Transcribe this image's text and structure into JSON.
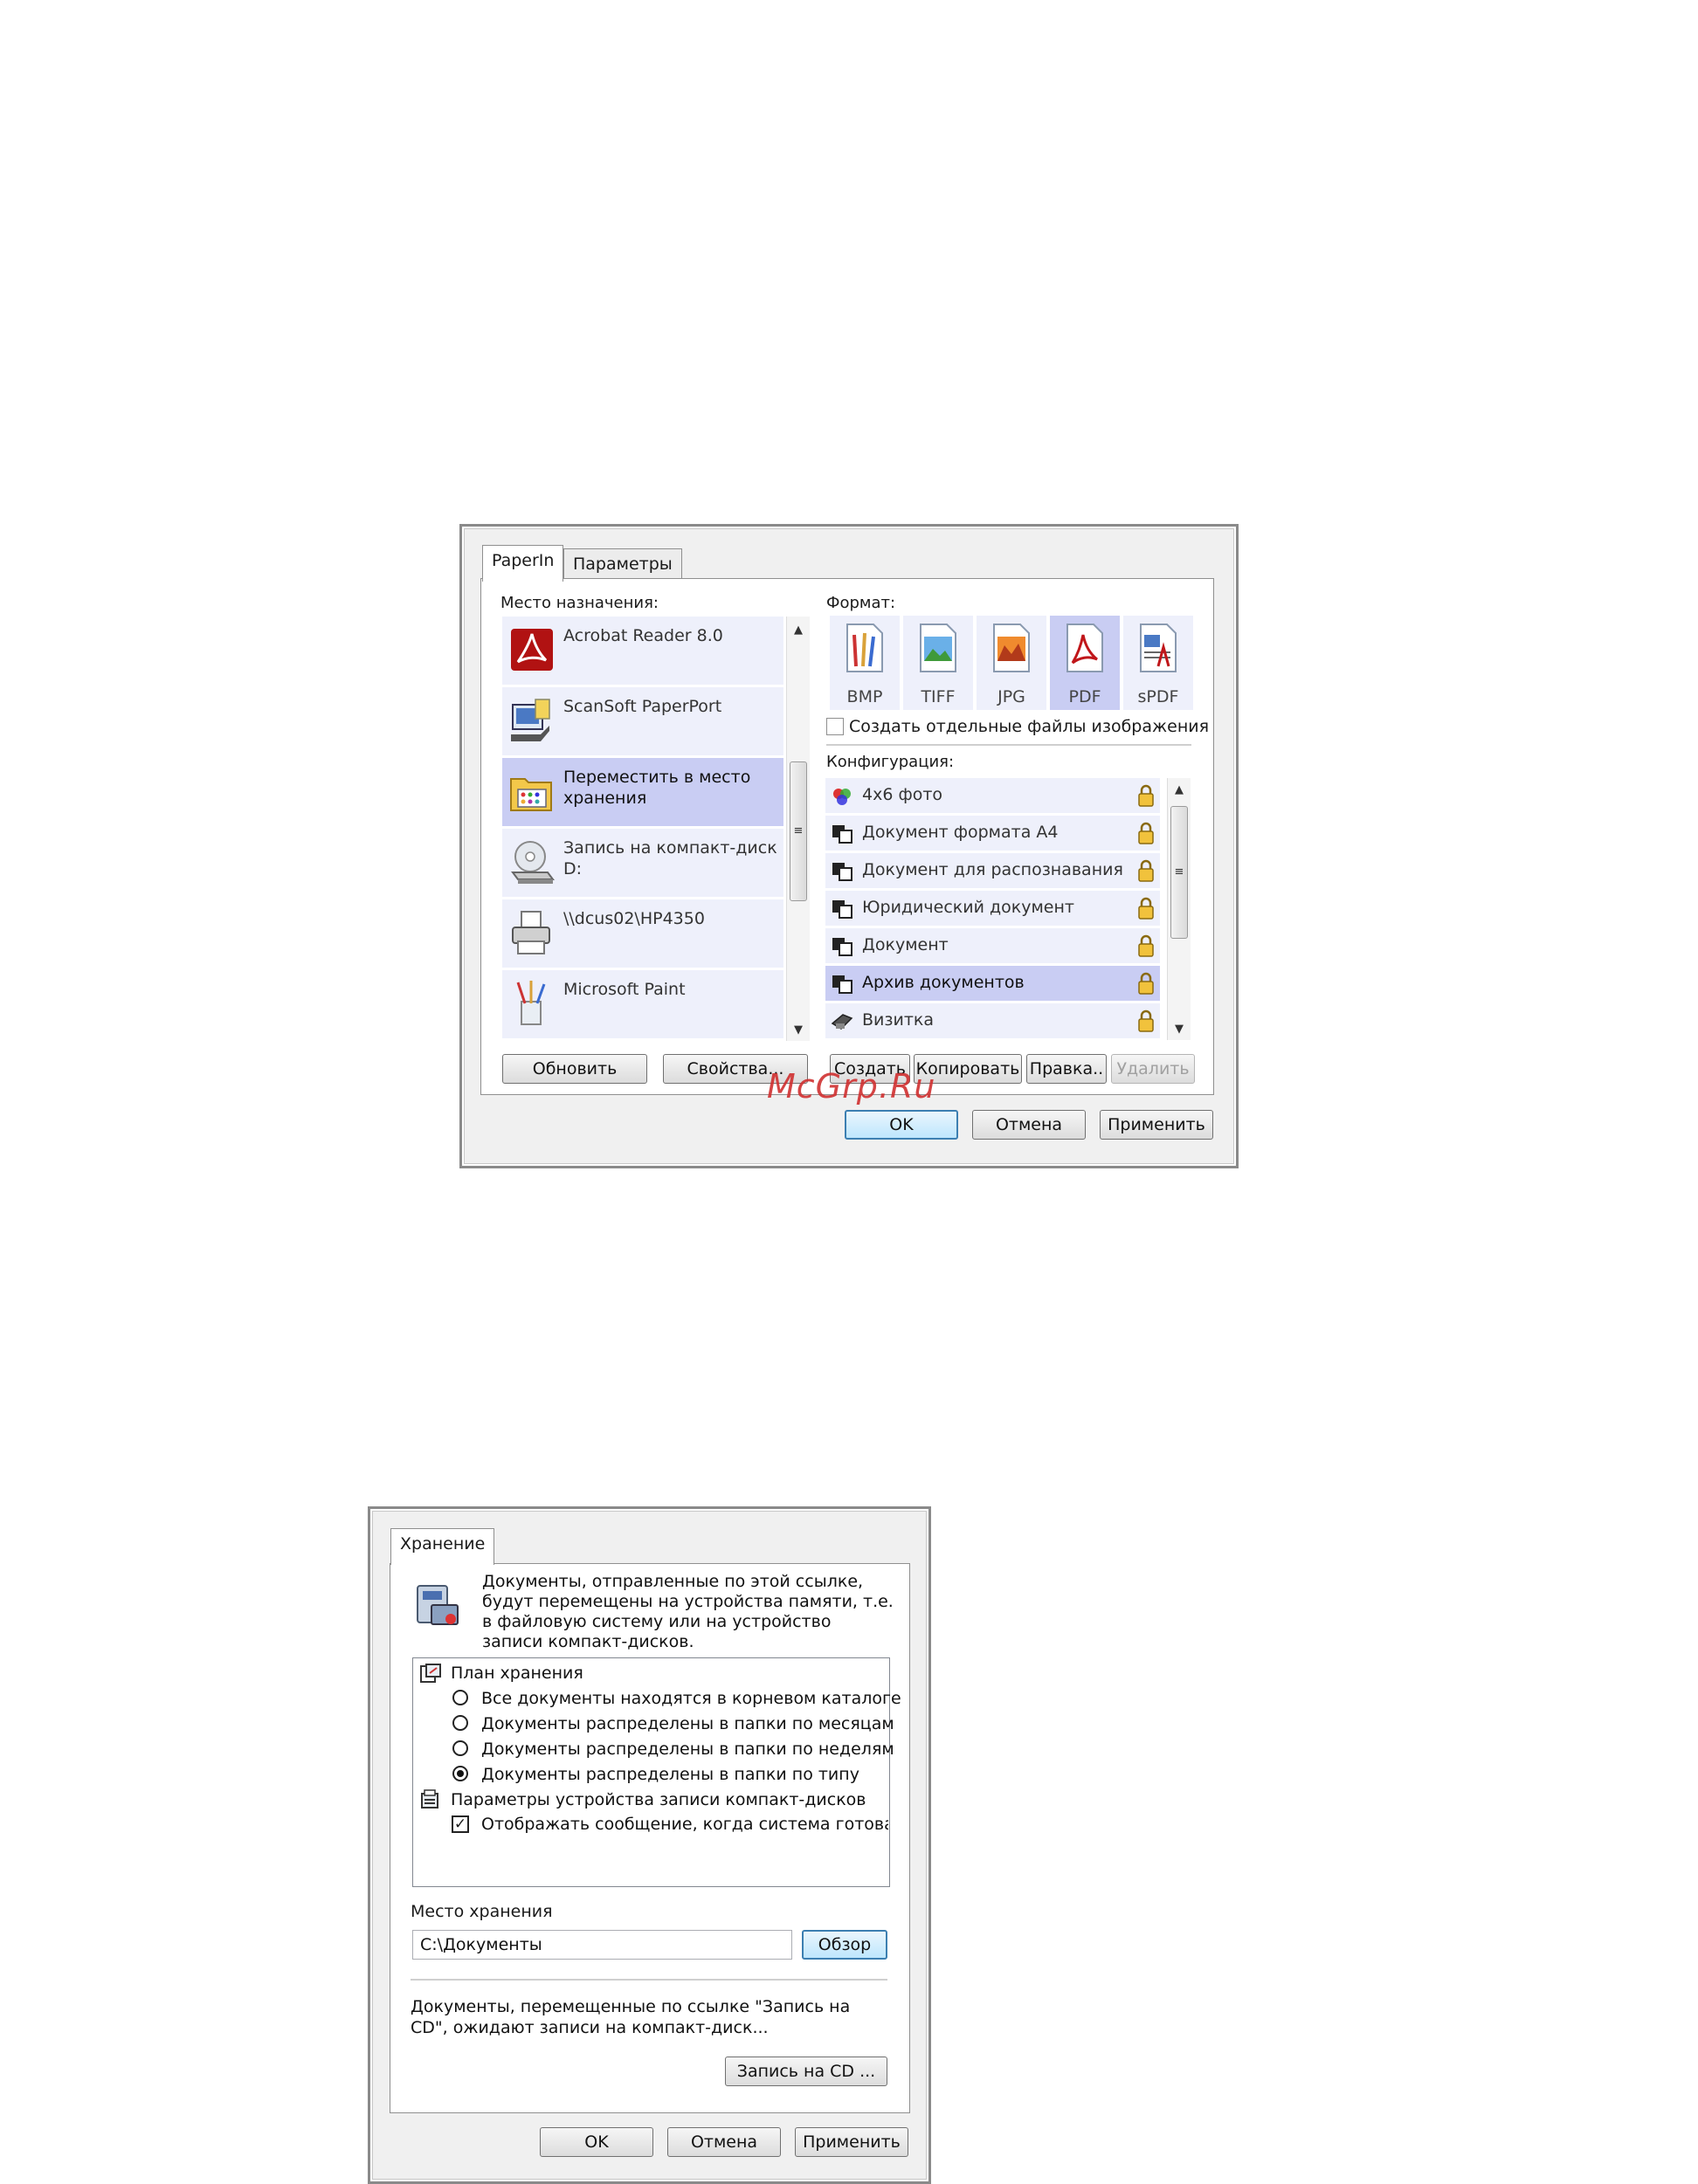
{
  "dialog1": {
    "tabs": [
      "PaperIn",
      "Параметры"
    ],
    "destination_label": "Место назначения:",
    "destinations": [
      {
        "label": "Acrobat Reader 8.0",
        "icon": "acrobat-icon"
      },
      {
        "label": "ScanSoft PaperPort",
        "icon": "paperport-icon"
      },
      {
        "label": "Переместить в место хранения",
        "icon": "storage-folder-icon",
        "selected": true
      },
      {
        "label": "Запись на компакт-диск D:",
        "icon": "cd-burner-icon"
      },
      {
        "label": "\\\\dcus02\\HP4350",
        "icon": "printer-icon"
      },
      {
        "label": "Microsoft Paint",
        "icon": "paint-brushes-icon"
      }
    ],
    "format_label": "Формат:",
    "formats": [
      {
        "label": "BMP",
        "icon": "bmp-file-icon"
      },
      {
        "label": "TIFF",
        "icon": "tiff-file-icon"
      },
      {
        "label": "JPG",
        "icon": "jpg-file-icon"
      },
      {
        "label": "PDF",
        "icon": "pdf-file-icon",
        "selected": true
      },
      {
        "label": "sPDF",
        "icon": "spdf-file-icon"
      }
    ],
    "separate_files_checkbox": "Создать отдельные файлы изображения",
    "config_label": "Конфигурация:",
    "configs": [
      {
        "label": "4x6 фото",
        "icon": "photo-config-icon"
      },
      {
        "label": "Документ формата А4",
        "icon": "document-config-icon"
      },
      {
        "label": "Документ для распознавания",
        "icon": "document-config-icon"
      },
      {
        "label": "Юридический документ",
        "icon": "document-config-icon"
      },
      {
        "label": "Документ",
        "icon": "document-config-icon"
      },
      {
        "label": "Архив документов",
        "icon": "document-config-icon",
        "selected": true
      },
      {
        "label": "Визитка",
        "icon": "business-card-config-icon"
      }
    ],
    "buttons": {
      "refresh": "Обновить",
      "properties": "Свойства...",
      "new": "Создать",
      "copy": "Копировать",
      "edit": "Правка..",
      "delete": "Удалить",
      "ok": "OK",
      "cancel": "Отмена",
      "apply": "Применить"
    }
  },
  "watermark": "McGrp.Ru",
  "dialog2": {
    "tab": "Хранение",
    "description": "Документы, отправленные по этой ссылке, будут перемещены на устройства памяти, т.е. в файловую систему или на устройство записи компакт-дисков.",
    "tree": {
      "group1": "План хранения",
      "options": [
        {
          "label": "Все документы находятся в корневом каталоге",
          "checked": false
        },
        {
          "label": "Документы распределены в папки по месяцам",
          "checked": false
        },
        {
          "label": "Документы распределены в папки по неделям",
          "checked": false
        },
        {
          "label": "Документы распределены в папки по типу",
          "checked": true
        }
      ],
      "group2": "Параметры устройства записи компакт-дисков",
      "checkbox": "Отображать сообщение, когда система готова к з"
    },
    "location_label": "Место хранения",
    "location_value": "C:\\Документы",
    "browse": "Обзор",
    "cd_note": "Документы, перемещенные по ссылке \"Запись на CD\", ожидают записи на компакт-диск...",
    "burn_button": "Запись на CD ...",
    "buttons": {
      "ok": "OK",
      "cancel": "Отмена",
      "apply": "Применить"
    }
  }
}
